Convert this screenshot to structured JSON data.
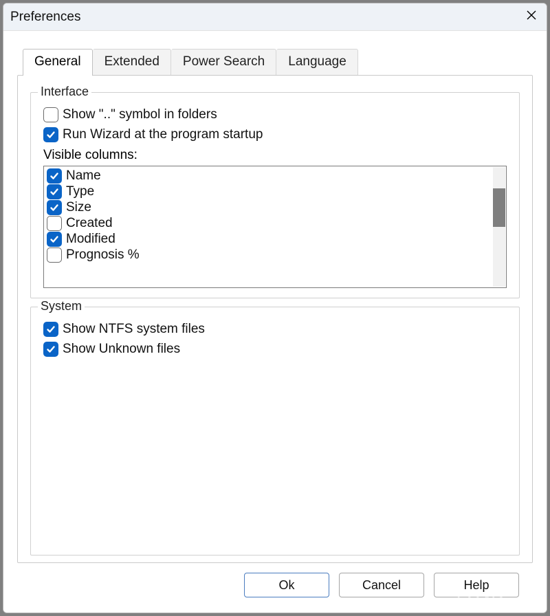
{
  "title": "Preferences",
  "tabs": {
    "general": {
      "label": "General"
    },
    "extended": {
      "label": "Extended"
    },
    "powersearch": {
      "label": "Power Search"
    },
    "language": {
      "label": "Language"
    }
  },
  "interface_group": {
    "legend": "Interface",
    "show_dotdot": {
      "label": "Show \"..\" symbol in folders",
      "checked": false
    },
    "run_wizard": {
      "label": "Run Wizard at the program startup",
      "checked": true
    },
    "visible_columns_caption": "Visible columns:",
    "columns": [
      {
        "label": "Name",
        "checked": true
      },
      {
        "label": "Type",
        "checked": true
      },
      {
        "label": "Size",
        "checked": true
      },
      {
        "label": "Created",
        "checked": false
      },
      {
        "label": "Modified",
        "checked": true
      },
      {
        "label": "Prognosis %",
        "checked": false
      }
    ]
  },
  "system_group": {
    "legend": "System",
    "show_ntfs": {
      "label": "Show NTFS system files",
      "checked": true
    },
    "show_unknown": {
      "label": "Show Unknown files",
      "checked": true
    }
  },
  "buttons": {
    "ok": "Ok",
    "cancel": "Cancel",
    "help": "Help"
  },
  "watermark": "LO4D.com"
}
